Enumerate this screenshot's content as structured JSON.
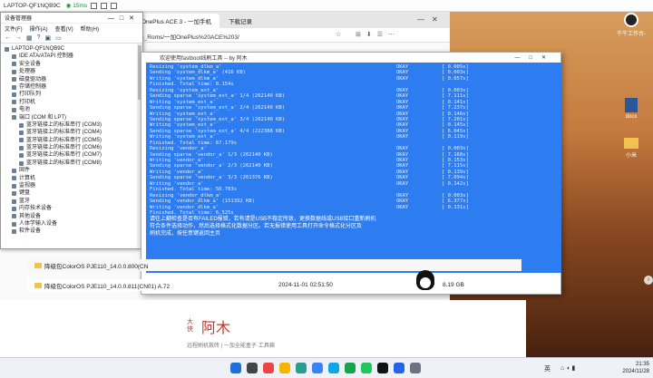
{
  "remote_bar": {
    "pc_name": "LAPTOP-QF1NQB9C",
    "signal_label": "◉ 15ms",
    "speed": "15ms"
  },
  "browser": {
    "tab1": "OnePlus ACE 3 - 一加手机",
    "tab2": "下载记录",
    "url": "tus_Roms/一加OnePlus%20ACE%203/",
    "side_letter": "大",
    "side_letter2": "侠",
    "file_rows": [
      {
        "name": "降级包ColorOS PJE110_14.0.0.800(CN"
      },
      {
        "name": "降级包ColorOS PJE110_14.0.0.811(CN01) A.72",
        "date": "2024-11-01 02:51:50",
        "size": "8.19 GB"
      }
    ],
    "logo_main": "阿木",
    "logo_small": "大侠",
    "subtitle": "远程刷机救砖 | 一加全能盒子·工具箱"
  },
  "device_manager": {
    "title": "设备管理器",
    "menus": [
      "文件(F)",
      "操作(A)",
      "查看(V)",
      "帮助(H)"
    ],
    "tree": [
      {
        "label": "LAPTOP-QF1NQB9C",
        "indent": 0
      },
      {
        "label": "IDE ATA/ATAPI 控制器",
        "indent": 1
      },
      {
        "label": "安全设备",
        "indent": 1
      },
      {
        "label": "处理器",
        "indent": 1
      },
      {
        "label": "磁盘驱动器",
        "indent": 1
      },
      {
        "label": "存储控制器",
        "indent": 1
      },
      {
        "label": "打印队列",
        "indent": 1
      },
      {
        "label": "打印机",
        "indent": 1
      },
      {
        "label": "电池",
        "indent": 1
      },
      {
        "label": "端口 (COM 和 LPT)",
        "indent": 1
      },
      {
        "label": "蓝牙链接上的标准串行 (COM3)",
        "indent": 2
      },
      {
        "label": "蓝牙链接上的标准串行 (COM4)",
        "indent": 2
      },
      {
        "label": "蓝牙链接上的标准串行 (COM5)",
        "indent": 2
      },
      {
        "label": "蓝牙链接上的标准串行 (COM6)",
        "indent": 2
      },
      {
        "label": "蓝牙链接上的标准串行 (COM7)",
        "indent": 2
      },
      {
        "label": "蓝牙链接上的标准串行 (COM8)",
        "indent": 2
      },
      {
        "label": "固件",
        "indent": 1
      },
      {
        "label": "计算机",
        "indent": 1
      },
      {
        "label": "监视器",
        "indent": 1
      },
      {
        "label": "键盘",
        "indent": 1
      },
      {
        "label": "蓝牙",
        "indent": 1
      },
      {
        "label": "内存技术设备",
        "indent": 1
      },
      {
        "label": "其他设备",
        "indent": 1
      },
      {
        "label": "人体学输入设备",
        "indent": 1
      },
      {
        "label": "软件设备",
        "indent": 1
      }
    ]
  },
  "terminal": {
    "title": "欢迎使用fastboot线刷工具 -- by 阿木",
    "lines": [
      {
        "text": "Resizing 'system_dlkm_a'",
        "status": "OKAY",
        "time": "[  0.005s]"
      },
      {
        "text": "Sending 'system_dlkm_a' (416 KB)",
        "status": "OKAY",
        "time": "[  0.003s]"
      },
      {
        "text": "Writing 'system_dlkm_a'",
        "status": "OKAY",
        "time": "[  0.057s]"
      },
      {
        "text": "Finished. Total time: 0.154s",
        "status": "",
        "time": ""
      },
      {
        "text": "Resizing 'system_ext_a'",
        "status": "OKAY",
        "time": "[  0.003s]"
      },
      {
        "text": "Sending sparse 'system_ext_a' 1/4 (262140 KB)",
        "status": "OKAY",
        "time": "[  7.111s]"
      },
      {
        "text": "Writing 'system_ext_a'",
        "status": "OKAY",
        "time": "[  0.141s]"
      },
      {
        "text": "Sending sparse 'system_ext_a' 2/4 (262140 KB)",
        "status": "OKAY",
        "time": "[  7.237s]"
      },
      {
        "text": "Writing 'system_ext_a'",
        "status": "OKAY",
        "time": "[  0.146s]"
      },
      {
        "text": "Sending sparse 'system_ext_a' 3/4 (262140 KB)",
        "status": "OKAY",
        "time": "[  7.201s]"
      },
      {
        "text": "Writing 'system_ext_a'",
        "status": "OKAY",
        "time": "[  0.145s]"
      },
      {
        "text": "Sending sparse 'system_ext_a' 4/4 (222388 KB)",
        "status": "OKAY",
        "time": "[  6.045s]"
      },
      {
        "text": "Writing 'system_ext_a'",
        "status": "OKAY",
        "time": "[  0.119s]"
      },
      {
        "text": "Finished. Total time: 67.179s",
        "status": "",
        "time": ""
      },
      {
        "text": "Resizing 'vendor_a'",
        "status": "OKAY",
        "time": "[  0.003s]"
      },
      {
        "text": "Sending sparse 'vendor_a' 1/3 (262140 KB)",
        "status": "OKAY",
        "time": "[  7.168s]"
      },
      {
        "text": "Writing 'vendor_a'",
        "status": "OKAY",
        "time": "[  0.153s]"
      },
      {
        "text": "Sending sparse 'vendor_a' 2/3 (262140 KB)",
        "status": "OKAY",
        "time": "[  7.115s]"
      },
      {
        "text": "Writing 'vendor_a'",
        "status": "OKAY",
        "time": "[  0.139s]"
      },
      {
        "text": "Sending sparse 'vendor_a' 3/3 (261376 KB)",
        "status": "OKAY",
        "time": "[  7.094s]"
      },
      {
        "text": "Writing 'vendor_a'",
        "status": "OKAY",
        "time": "[  0.142s]"
      },
      {
        "text": "Finished. Total time: 50.783s",
        "status": "",
        "time": ""
      },
      {
        "text": "Resizing 'vendor_dlkm_a'",
        "status": "OKAY",
        "time": "[  0.003s]"
      },
      {
        "text": "Sending 'vendor_dlkm_a' (151392 KB)",
        "status": "OKAY",
        "time": "[  6.377s]"
      },
      {
        "text": "Writing 'vendor_dlkm_a'",
        "status": "OKAY",
        "time": "[  0.131s]"
      },
      {
        "text": "Finished. Total time: 6.525s",
        "status": "",
        "time": ""
      }
    ],
    "cn_lines": [
      "请往上翻检查是否有FAILED报错，若有请是USB不稳定所致，更换数据线或USB接口重新刷机",
      "符合条件选择动作，然后选择格式化数据分区。若无报错使用工具打开命令格式化分区及",
      "刷机完成，按任意键返回主页"
    ]
  },
  "desktop": {
    "icons": [
      {
        "label": "千牛工作台-"
      },
      {
        "label": "docx"
      },
      {
        "label": "小米"
      }
    ]
  },
  "taskbar": {
    "ime": "英",
    "time": "21:35",
    "date": "2024/11/28"
  },
  "colors": {
    "terminal_bg": "#2d7cf0",
    "brand_red": "#c0392b"
  }
}
